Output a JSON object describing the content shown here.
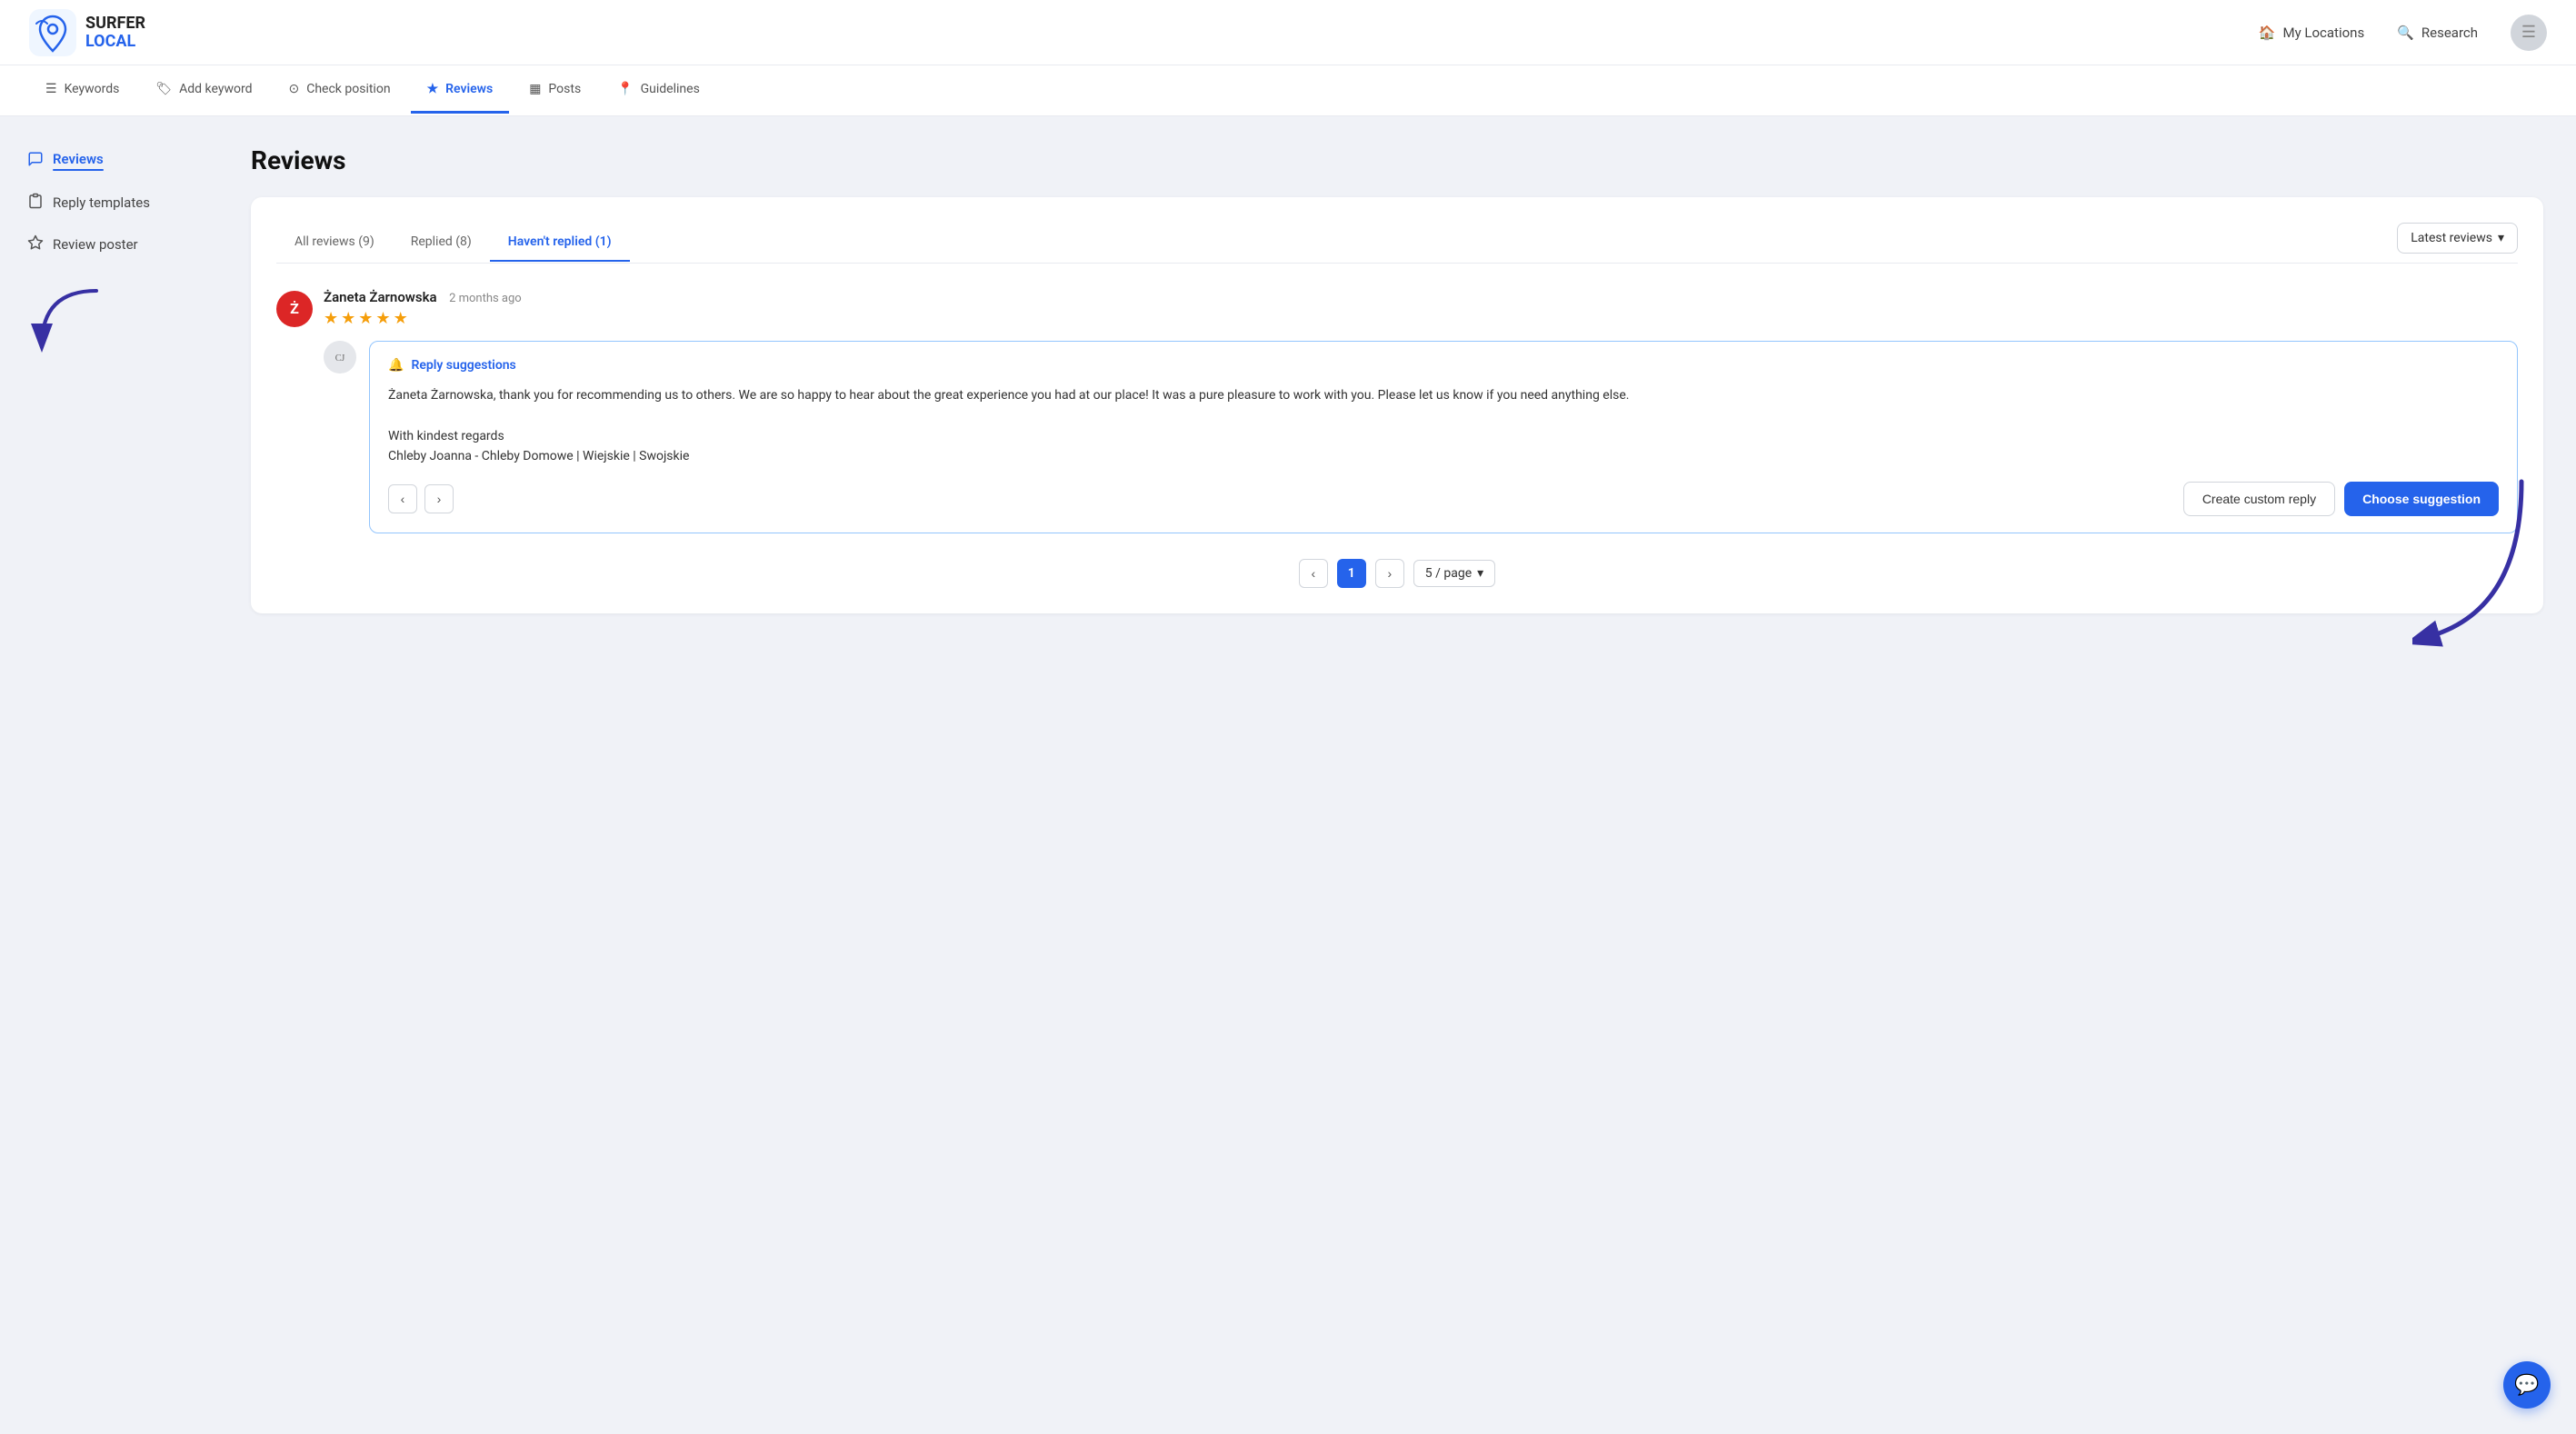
{
  "app": {
    "logo_line1": "SURFER",
    "logo_line2": "LOCAL"
  },
  "header": {
    "my_locations_label": "My Locations",
    "research_label": "Research"
  },
  "topnav": {
    "items": [
      {
        "id": "keywords",
        "label": "Keywords",
        "icon": "list"
      },
      {
        "id": "add-keyword",
        "label": "Add keyword",
        "icon": "tag"
      },
      {
        "id": "check-position",
        "label": "Check position",
        "icon": "target"
      },
      {
        "id": "reviews",
        "label": "Reviews",
        "icon": "star",
        "active": true
      },
      {
        "id": "posts",
        "label": "Posts",
        "icon": "grid"
      },
      {
        "id": "guidelines",
        "label": "Guidelines",
        "icon": "map-pin"
      }
    ]
  },
  "sidebar": {
    "items": [
      {
        "id": "reviews",
        "label": "Reviews",
        "active": true,
        "icon": "chat"
      },
      {
        "id": "reply-templates",
        "label": "Reply templates",
        "icon": "clipboard"
      },
      {
        "id": "review-poster",
        "label": "Review poster",
        "icon": "star-badge"
      }
    ]
  },
  "content": {
    "page_title": "Reviews",
    "tabs": [
      {
        "id": "all",
        "label": "All reviews (9)"
      },
      {
        "id": "replied",
        "label": "Replied (8)"
      },
      {
        "id": "unreplied",
        "label": "Haven't replied (1)",
        "active": true
      }
    ],
    "sort_label": "Latest reviews",
    "review": {
      "reviewer_initial": "Ż",
      "reviewer_name": "Żaneta Żarnowska",
      "reviewer_time": "2 months ago",
      "stars": 5,
      "business_name": "Chleby Joanna - Chleby Domowe | Wiejskie | Swojskie",
      "suggestion_header": "Reply suggestions",
      "suggestion_text_p1": "Żaneta Żarnowska, thank you for recommending us to others. We are so happy to hear about the great experience you had at our place! It was a pure pleasure to work with you. Please let us know if you need anything else.",
      "suggestion_text_p2": "With kindest regards",
      "suggestion_text_p3": "Chleby Joanna - Chleby Domowe | Wiejskie | Swojskie",
      "btn_custom_reply": "Create custom reply",
      "btn_choose_suggestion": "Choose suggestion"
    },
    "pagination": {
      "current_page": "1",
      "per_page_label": "5 / page"
    }
  }
}
